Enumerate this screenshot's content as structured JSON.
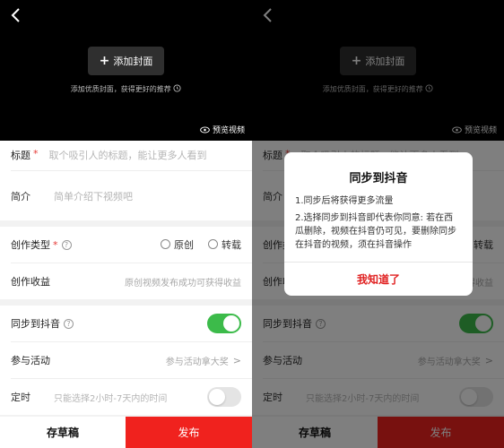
{
  "colors": {
    "accent_red": "#f0221e",
    "toggle_green": "#3cbb4a",
    "required_star": "#e53935"
  },
  "video": {
    "back_icon": "chevron-left-icon",
    "add_cover_label": "添加封面",
    "add_cover_plus": "+",
    "cover_tip": "添加优质封面，获得更好的推荐",
    "preview_label": "预览视频",
    "preview_icon": "eye-icon"
  },
  "form": {
    "title_label": "标题",
    "required_mark": "*",
    "title_placeholder": "取个吸引人的标题，能让更多人看到",
    "intro_label": "简介",
    "intro_placeholder": "简单介绍下视频吧",
    "type_label": "创作类型",
    "help_mark": "?",
    "type_option_original": "原创",
    "type_option_repost": "转载",
    "income_label": "创作收益",
    "income_text": "原创视频发布成功可获得收益",
    "sync_label": "同步到抖音",
    "sync_on": true,
    "activity_label": "参与活动",
    "activity_text": "参与活动拿大奖",
    "chevron": ">",
    "timing_label": "定时",
    "timing_text": "只能选择2小时-7天内的时间",
    "timing_on": false
  },
  "bottom": {
    "draft_label": "存草稿",
    "publish_label": "发布"
  },
  "dialog": {
    "title": "同步到抖音",
    "line1": "1.同步后将获得更多流量",
    "line2": "2.选择同步到抖音即代表你同意: 若在西瓜删除，视频在抖音仍可见，要删除同步在抖音的视频，须在抖音操作",
    "confirm_label": "我知道了"
  }
}
